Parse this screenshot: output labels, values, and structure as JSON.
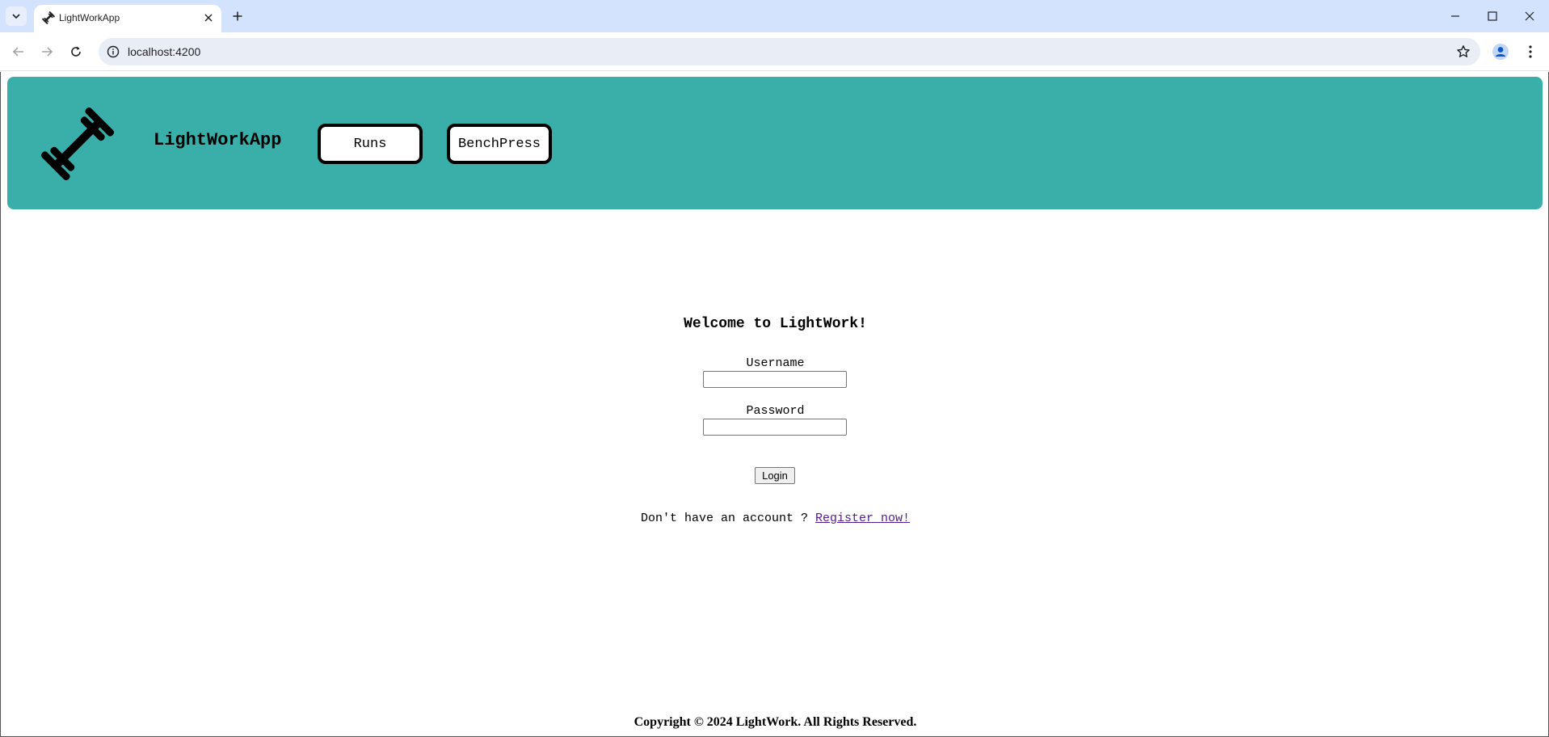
{
  "browser": {
    "tab_title": "LightWorkApp",
    "url": "localhost:4200"
  },
  "header": {
    "app_title": "LightWorkApp",
    "nav": [
      {
        "label": "Runs"
      },
      {
        "label": "BenchPress"
      }
    ],
    "color": "#3aafa9"
  },
  "login": {
    "welcome": "Welcome to LightWork!",
    "username_label": "Username",
    "username_value": "",
    "password_label": "Password",
    "password_value": "",
    "login_button": "Login",
    "register_prompt": "Don't have an account ? ",
    "register_link": "Register now!"
  },
  "footer": {
    "copyright": "Copyright © 2024 LightWork. All Rights Reserved."
  },
  "icons": {
    "logo": "dumbbell-icon",
    "favicon": "dumbbell-icon"
  }
}
